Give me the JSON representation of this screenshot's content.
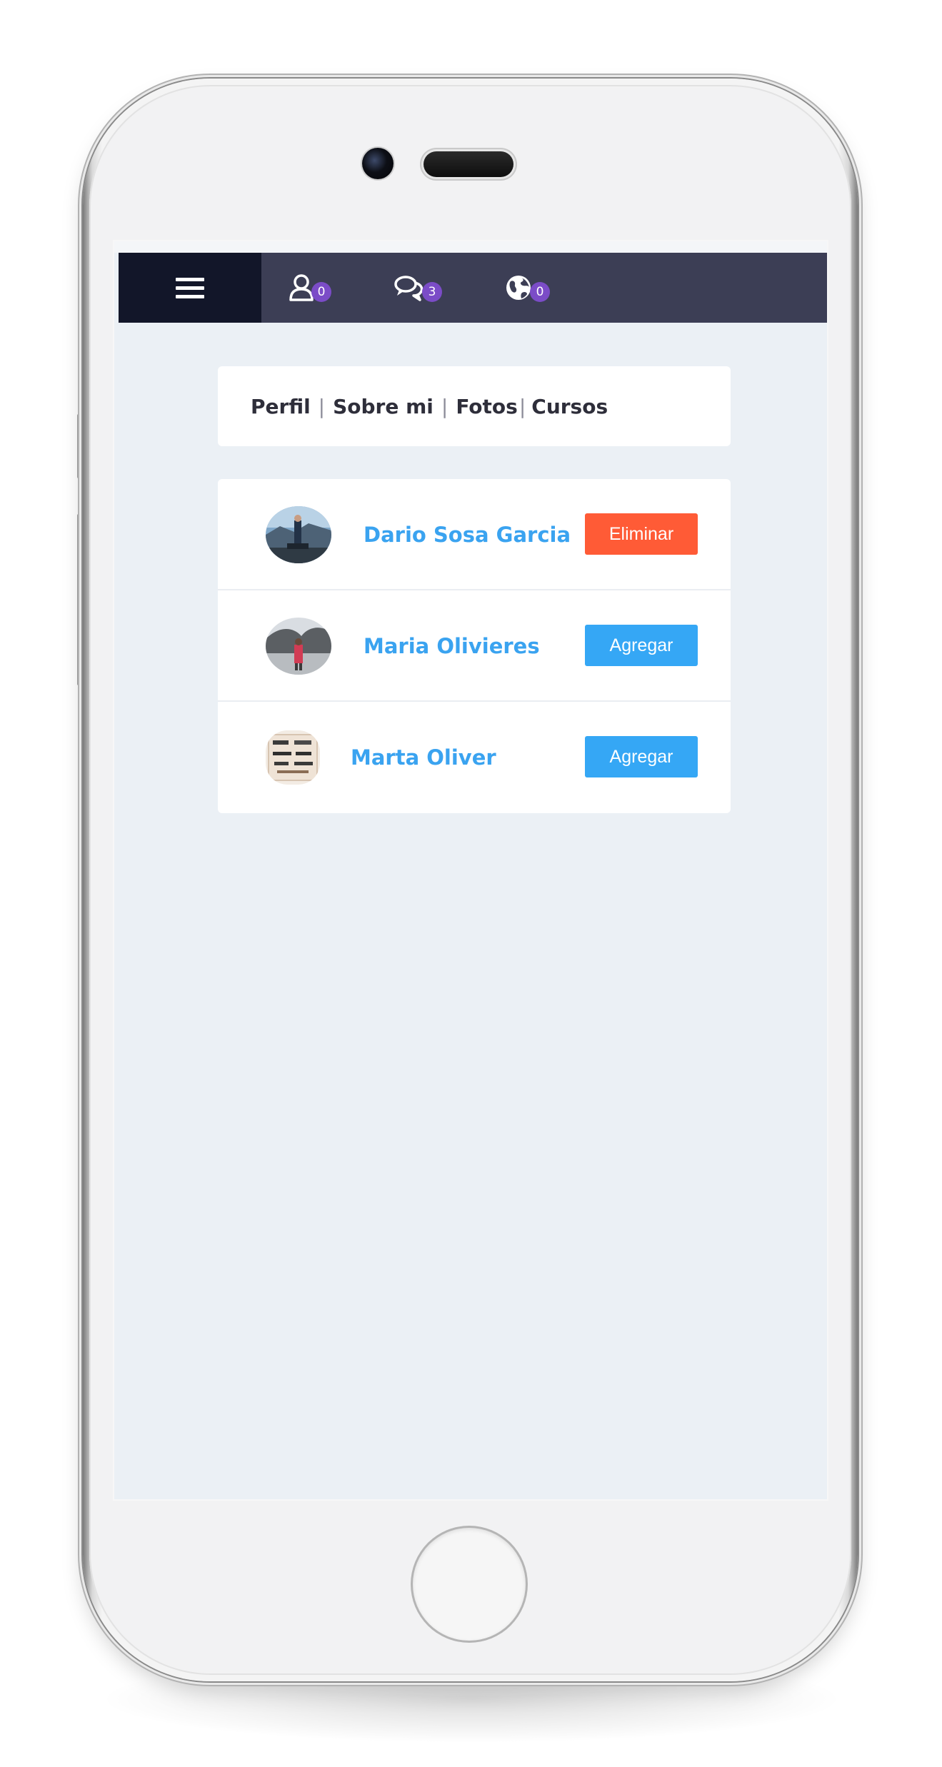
{
  "topbar": {
    "menu_icon": "hamburger-icon",
    "notifications": [
      {
        "icon": "user-icon",
        "count": "0"
      },
      {
        "icon": "comments-icon",
        "count": "3"
      },
      {
        "icon": "globe-icon",
        "count": "0"
      }
    ],
    "colors": {
      "bar": "#3c3e55",
      "menu_bg": "#121629",
      "badge": "#7b4cc7"
    }
  },
  "profile_nav": {
    "links": [
      "Perfil",
      "Sobre mi",
      "Fotos",
      "Cursos"
    ],
    "separator": "|"
  },
  "friends": [
    {
      "name": "Dario Sosa Garcia",
      "action": "Eliminar",
      "action_color": "#ff5b36"
    },
    {
      "name": "Maria Olivieres",
      "action": "Agregar",
      "action_color": "#35a7f5"
    },
    {
      "name": "Marta Oliver",
      "action": "Agregar",
      "action_color": "#35a7f5"
    }
  ]
}
